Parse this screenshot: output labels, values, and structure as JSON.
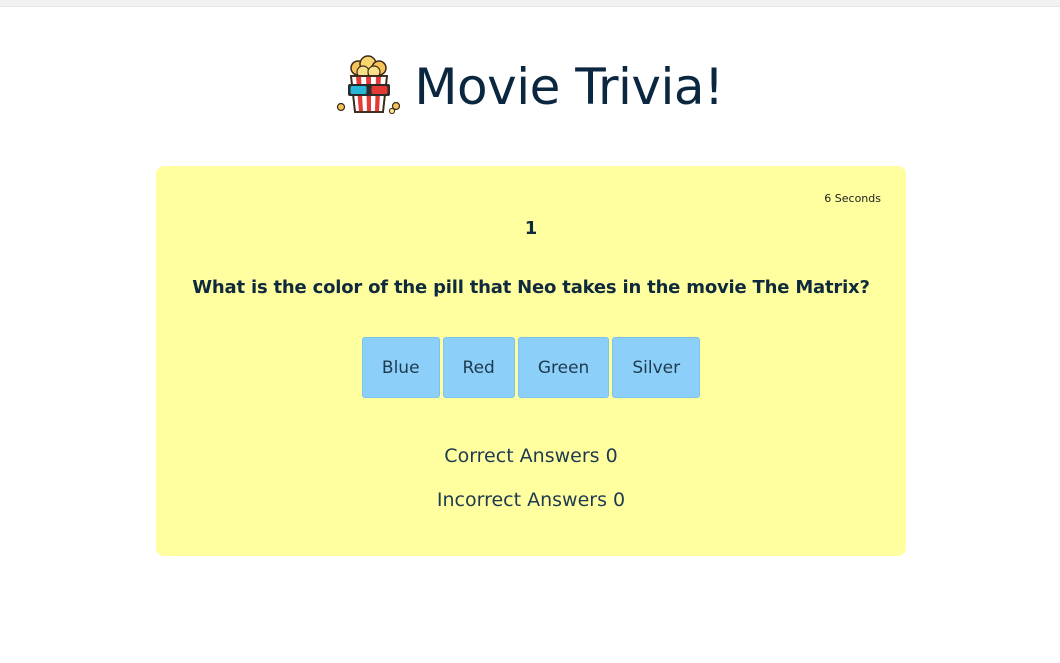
{
  "header": {
    "title": "Movie Trivia!",
    "logo_icon": "popcorn-3d-glasses-icon"
  },
  "quiz": {
    "timer_text": "6 Seconds",
    "question_number": "1",
    "question_text": "What is the color of the pill that Neo takes in the movie The Matrix?",
    "answers": [
      "Blue",
      "Red",
      "Green",
      "Silver"
    ],
    "correct_text": "Correct Answers 0",
    "incorrect_text": "Incorrect Answers 0"
  },
  "colors": {
    "card_background": "#ffff9f",
    "answer_button": "#8ccff8",
    "text": "#0f2a3d"
  }
}
